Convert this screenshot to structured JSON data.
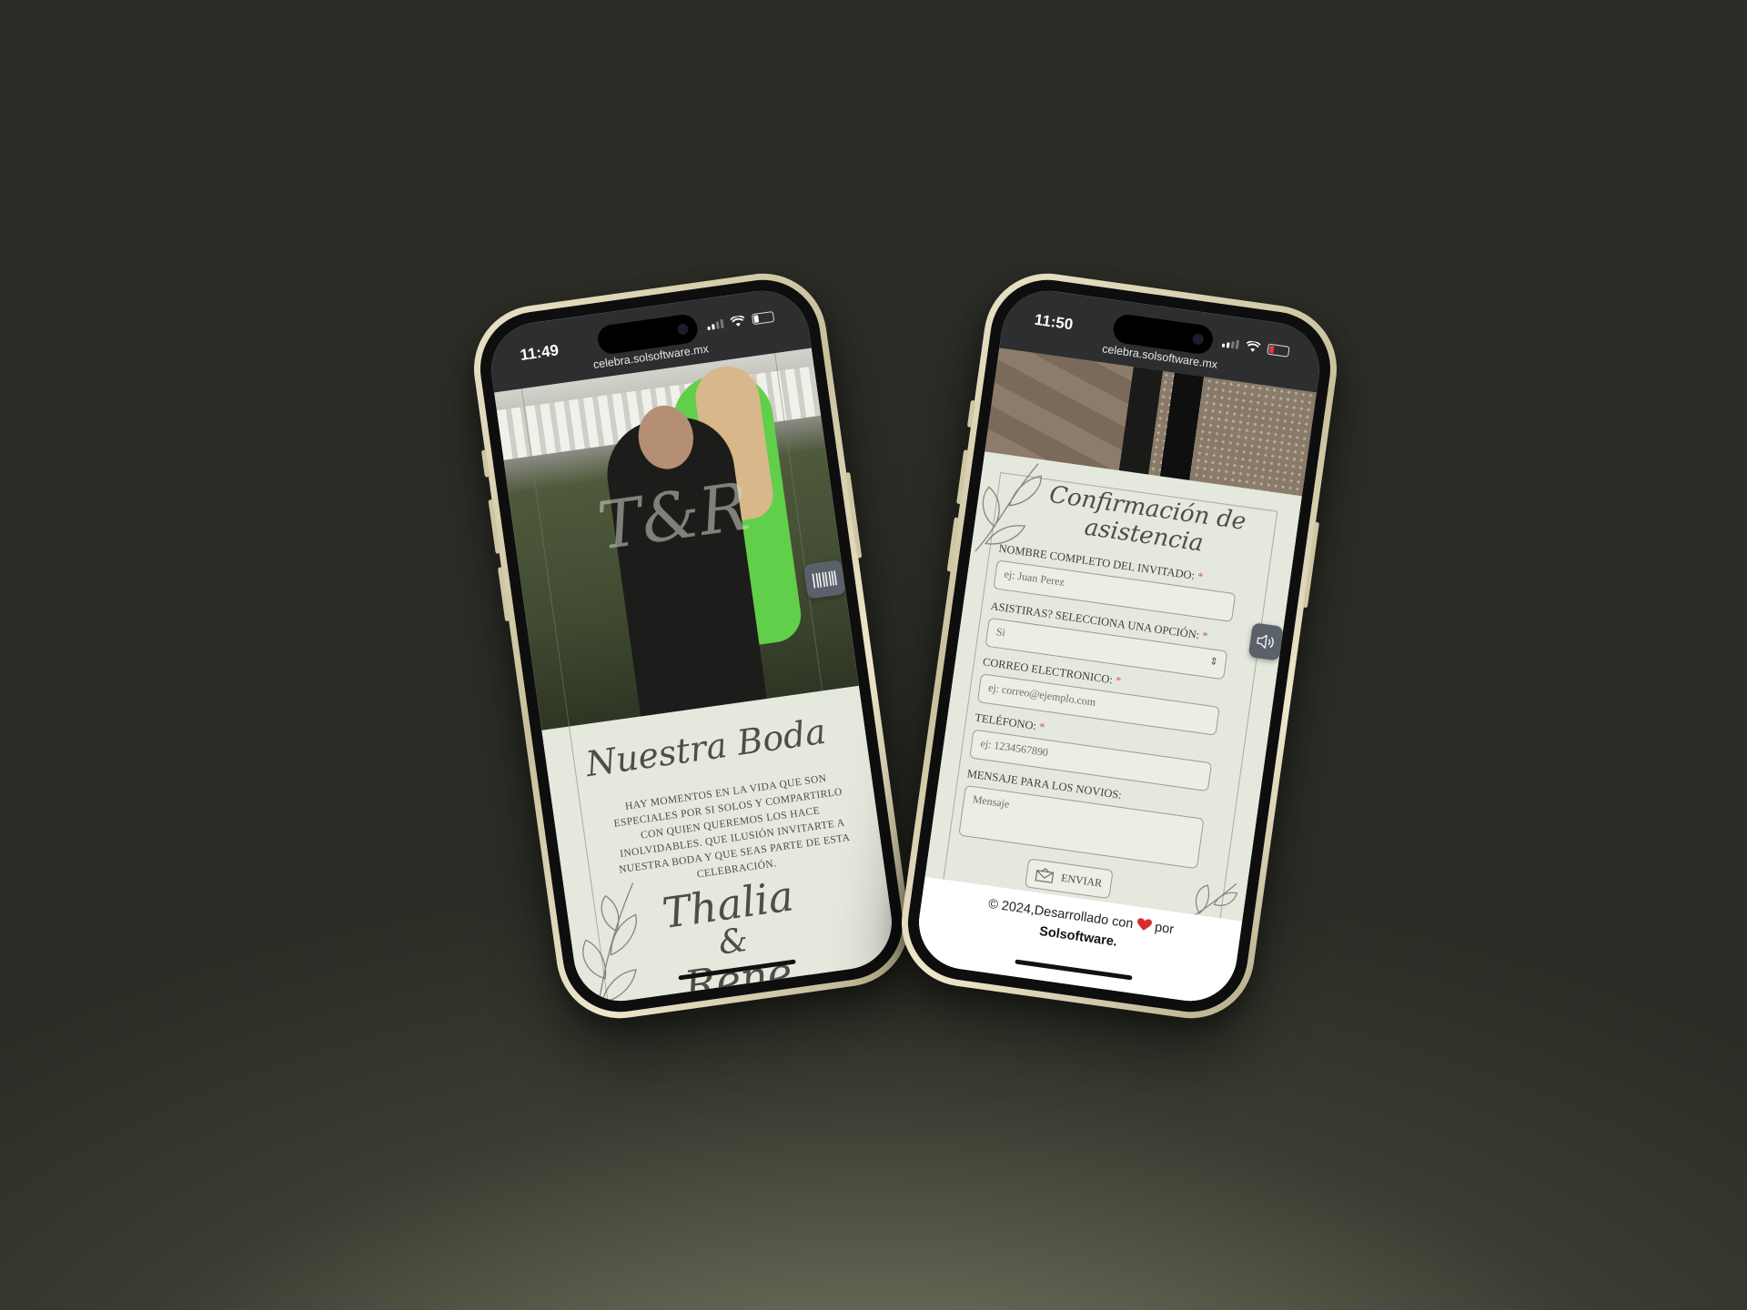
{
  "left_phone": {
    "status": {
      "time": "11:49",
      "url": "celebra.solsoftware.mx"
    },
    "hero": {
      "monogram": "T&R"
    },
    "invitation": {
      "heading": "Nuestra Boda",
      "body": "HAY MOMENTOS EN LA VIDA QUE SON ESPECIALES POR SI SOLOS Y COMPARTIRLO CON QUIEN QUEREMOS LOS HACE INOLVIDABLES. QUE ILUSIÓN INVITARTE A NUESTRA BODA Y QUE SEAS PARTE DE ESTA CELEBRACIÓN.",
      "bride": "Thalia",
      "amp": "&",
      "groom": "Rene"
    },
    "icons": {
      "music": "barcode-music-icon"
    }
  },
  "right_phone": {
    "status": {
      "time": "11:50",
      "url": "celebra.solsoftware.mx"
    },
    "form": {
      "title_line1": "Confirmación de",
      "title_line2": "asistencia",
      "name_label": "NOMBRE COMPLETO DEL INVITADO:",
      "name_placeholder": "ej: Juan Perez",
      "attend_label": "ASISTIRAS? SELECCIONA UNA OPCIÓN:",
      "attend_value": "Si",
      "email_label": "CORREO ELECTRONICO:",
      "email_placeholder": "ej: correo@ejemplo.com",
      "phone_label": "TELÉFONO:",
      "phone_placeholder": "ej: 1234567890",
      "message_label": "MENSAJE PARA LOS NOVIOS:",
      "message_placeholder": "Mensaje",
      "required_mark": "*",
      "send_label": "ENVIAR"
    },
    "footer": {
      "text_pre": "© 2024,Desarrollado con",
      "text_post": "por",
      "brand": "Solsoftware."
    },
    "icons": {
      "speaker": "speaker-icon",
      "heart": "heart-icon",
      "envelope": "envelope-icon"
    },
    "colors": {
      "required": "#d45a5a",
      "heart": "#d92b2b"
    }
  }
}
